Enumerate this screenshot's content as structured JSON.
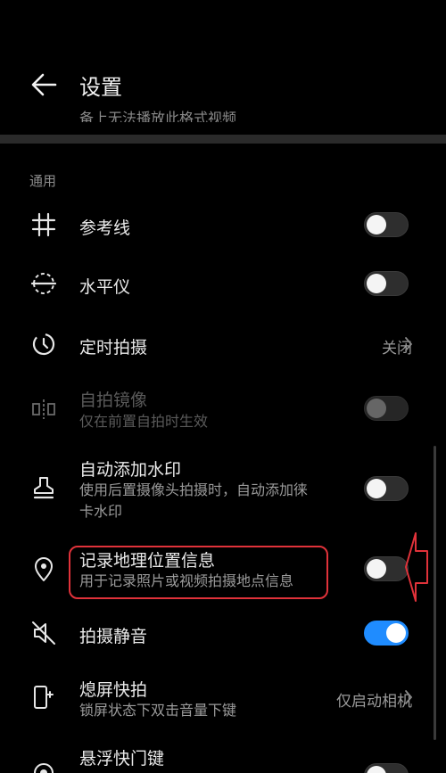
{
  "header": {
    "title": "设置",
    "clipped_text": "备上无法播放此格式视频"
  },
  "section_general": "通用",
  "rows": [
    {
      "label": "参考线",
      "icon": "grid-icon",
      "toggle": "off"
    },
    {
      "label": "水平仪",
      "icon": "level-icon",
      "toggle": "off"
    },
    {
      "label": "定时拍摄",
      "icon": "timer-icon",
      "value": "关闭"
    },
    {
      "label": "自拍镜像",
      "sub": "仅在前置自拍时生效",
      "icon": "mirror-icon",
      "toggle": "disabled"
    },
    {
      "label": "自动添加水印",
      "sub1": "使用后置摄像头拍摄时，自动添加徕",
      "sub2": "卡水印",
      "icon": "stamp-icon",
      "toggle": "off"
    },
    {
      "label": "记录地理位置信息",
      "sub": "用于记录照片或视频拍摄地点信息",
      "icon": "location-pin-icon",
      "toggle": "off"
    },
    {
      "label": "拍摄静音",
      "icon": "mute-icon",
      "toggle": "on"
    },
    {
      "label": "熄屏快拍",
      "sub": "锁屏状态下双击音量下键",
      "icon": "phone-volume-icon",
      "value": "仅启动相机"
    },
    {
      "label": "悬浮快门键",
      "icon": "floating-shutter-icon",
      "toggle": "off"
    }
  ],
  "colors": {
    "accent": "#1f8cff",
    "highlight": "#e0323a",
    "background": "#000000"
  }
}
